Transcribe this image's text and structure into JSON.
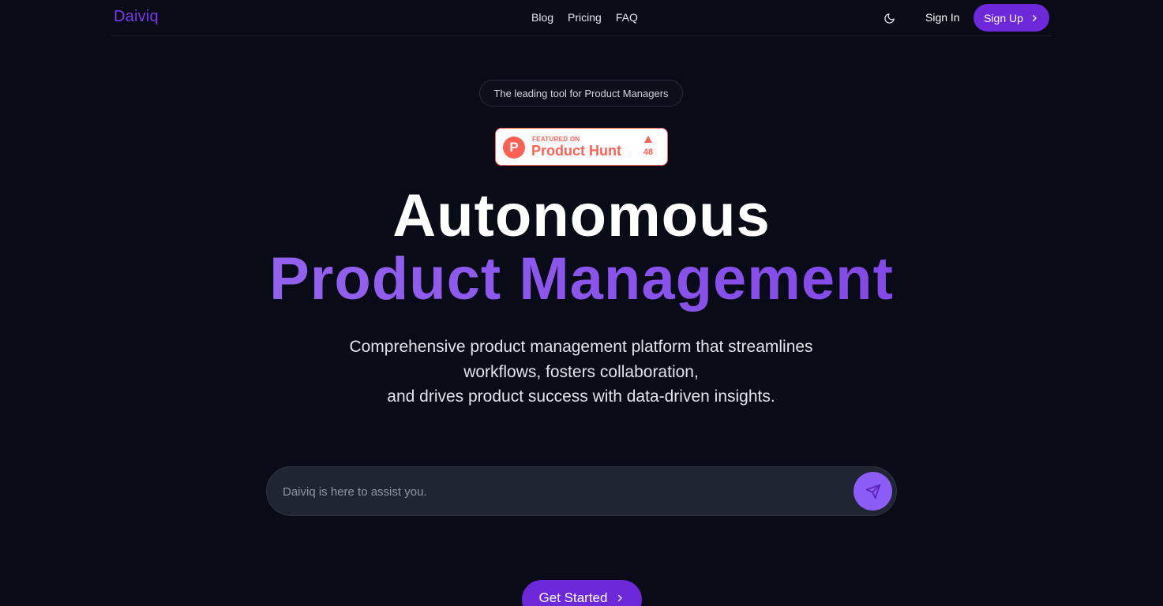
{
  "nav": {
    "logo": "Daiviq",
    "links": [
      {
        "label": "Blog"
      },
      {
        "label": "Pricing"
      },
      {
        "label": "FAQ"
      }
    ],
    "theme_toggle_icon": "moon-icon",
    "sign_in_label": "Sign In",
    "sign_up_label": "Sign Up"
  },
  "hero": {
    "pill_text": "The leading tool for Product Managers",
    "product_hunt": {
      "featured_label": "FEATURED ON",
      "name": "Product Hunt",
      "logo_letter": "P",
      "upvotes": "48"
    },
    "headline_line1": "Autonomous",
    "headline_line2": "Product Management",
    "subtext_lines": [
      "Comprehensive product management platform that streamlines",
      "workflows, fosters collaboration,",
      "and drives product success with data-driven insights."
    ]
  },
  "chat": {
    "placeholder": "Daiviq is here to assist you.",
    "value": "",
    "send_icon": "send-icon"
  },
  "cta": {
    "get_started_label": "Get Started"
  },
  "colors": {
    "background": "#090b16",
    "accent": "#6d28d9",
    "accent_light": "#8b5cf6",
    "product_hunt": "#ff6154"
  }
}
